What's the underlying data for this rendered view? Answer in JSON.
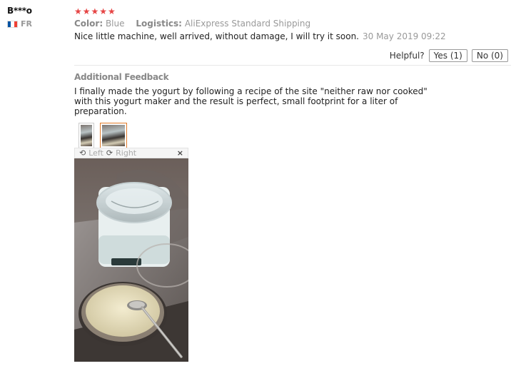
{
  "user": {
    "name": "B***o",
    "country": "FR",
    "flag_colors": [
      "#0055a4",
      "#ffffff",
      "#ef4135"
    ]
  },
  "review": {
    "stars": 5,
    "star_glyphs": "★★★★★",
    "color_label": "Color:",
    "color_value": "Blue",
    "logistics_label": "Logistics:",
    "logistics_value": "AliExpress Standard Shipping",
    "text": "Nice little machine, well arrived, without damage, I will try it soon.",
    "date": "30 May 2019 09:22",
    "helpful_label": "Helpful?",
    "yes_label": "Yes (1)",
    "no_label": "No (0)"
  },
  "additional": {
    "title": "Additional Feedback",
    "text": "I finally made the yogurt by following a recipe of the site \"neither raw nor cooked\" with this yogurt maker and the result is perfect, small footprint for a liter of preparation."
  },
  "viewer": {
    "left_label": "Left",
    "right_label": "Right",
    "close_glyph": "×",
    "rotate_left_icon": "rotate-left-icon",
    "rotate_right_icon": "rotate-right-icon"
  },
  "colors": {
    "star": "#e64545",
    "active_thumb": "#e07b2a"
  }
}
